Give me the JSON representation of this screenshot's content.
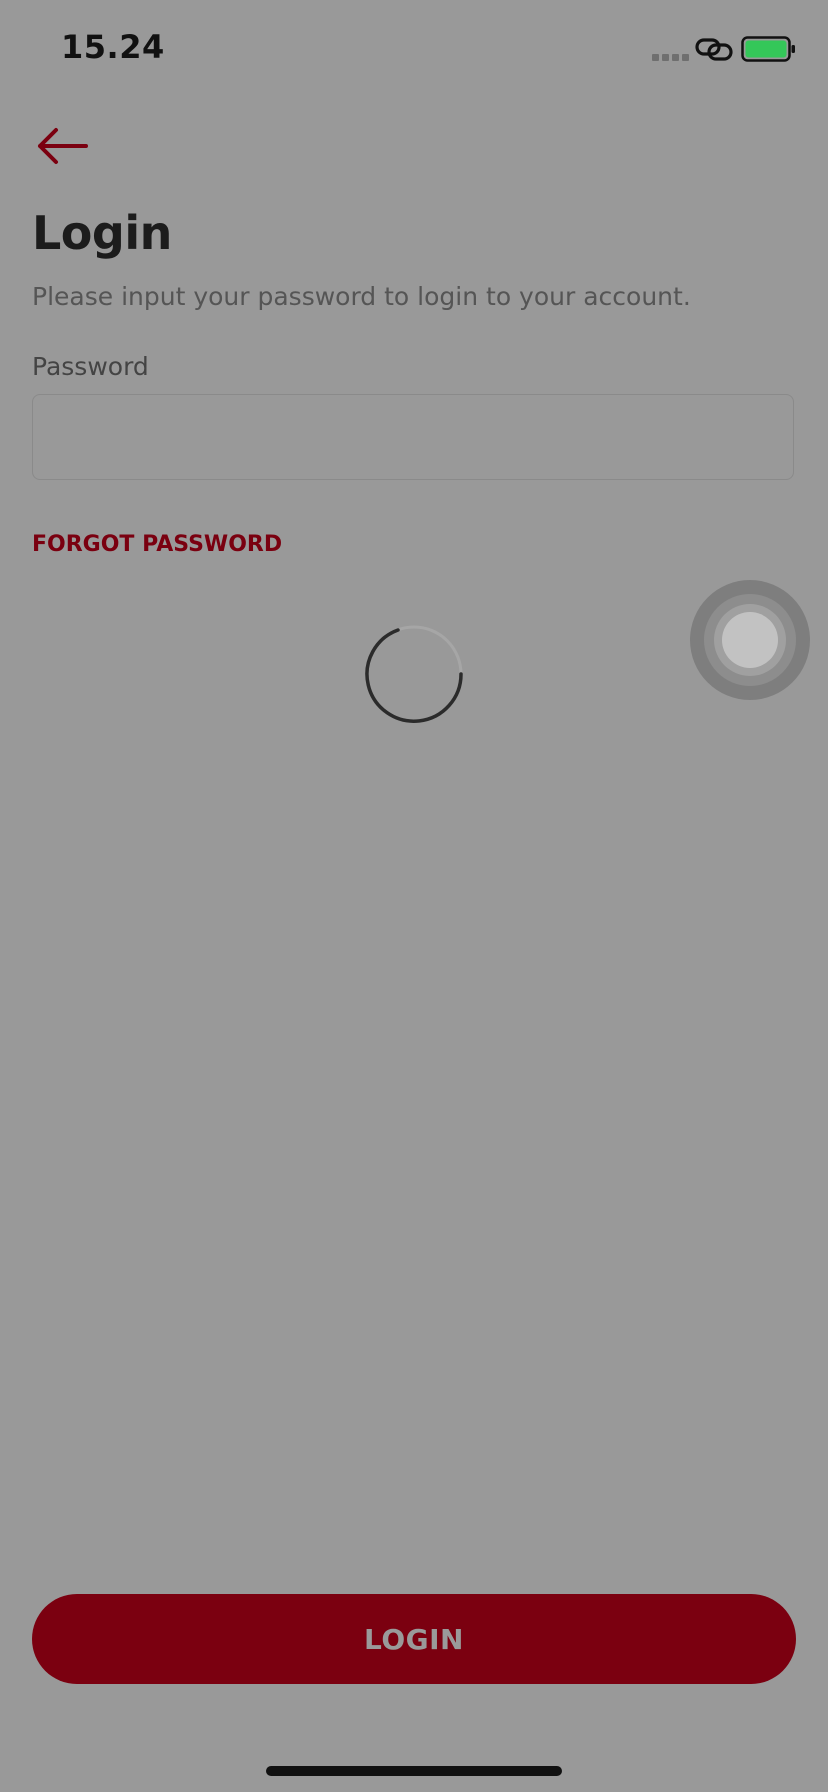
{
  "status_bar": {
    "time": "15.24",
    "icons": [
      "signal-dots-icon",
      "link-icon",
      "battery-icon"
    ],
    "battery_color": "#34c759"
  },
  "nav": {
    "back_icon": "arrow-left-icon",
    "accent_color": "#7b0010"
  },
  "header": {
    "title": "Login",
    "subtitle": "Please input your password to login to your account."
  },
  "form": {
    "password_label": "Password",
    "password_value": "",
    "password_placeholder": "",
    "forgot_password_label": "FORGOT PASSWORD"
  },
  "loading": {
    "spinner_icon": "loading-spinner-icon"
  },
  "footer": {
    "login_label": "LOGIN"
  },
  "colors": {
    "overlay_background": "#999999",
    "brand_red": "#7b0010",
    "title_text": "#1c1c1c"
  }
}
